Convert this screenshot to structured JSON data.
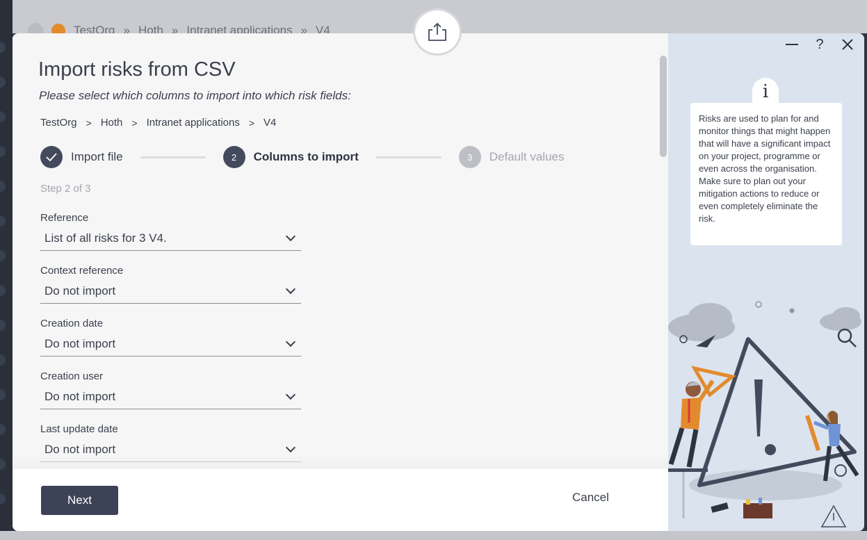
{
  "background": {
    "breadcrumb": [
      "TestOrg",
      "Hoth",
      "Intranet applications",
      "V4"
    ]
  },
  "dialog": {
    "title": "Import risks from CSV",
    "subtitle": "Please select which columns to import into which risk fields:",
    "breadcrumb": [
      "TestOrg",
      "Hoth",
      "Intranet applications",
      "V4"
    ],
    "breadcrumb_separator": ">",
    "steps": [
      {
        "number": "1",
        "label": "Import file",
        "state": "done"
      },
      {
        "number": "2",
        "label": "Columns to import",
        "state": "active"
      },
      {
        "number": "3",
        "label": "Default values",
        "state": "future"
      }
    ],
    "step_count": "Step 2 of 3",
    "fields": [
      {
        "label": "Reference",
        "value": "List of all risks for 3 V4."
      },
      {
        "label": "Context reference",
        "value": "Do not import"
      },
      {
        "label": "Creation date",
        "value": "Do not import"
      },
      {
        "label": "Creation user",
        "value": "Do not import"
      },
      {
        "label": "Last update date",
        "value": "Do not import"
      }
    ],
    "footer": {
      "next_label": "Next",
      "cancel_label": "Cancel"
    }
  },
  "help_panel": {
    "info_glyph": "i",
    "text": "Risks are used to plan for and monitor things that might happen that will have a significant impact on your project, programme or even across the organisation. Make sure to plan out your mitigation actions to reduce or even completely eliminate the risk.",
    "controls": {
      "minimize": "—",
      "help": "?",
      "close": "✕"
    }
  },
  "colors": {
    "primary": "#3c4356",
    "panel_bg": "#dbe3ee",
    "accent_orange": "#e38a2c"
  }
}
